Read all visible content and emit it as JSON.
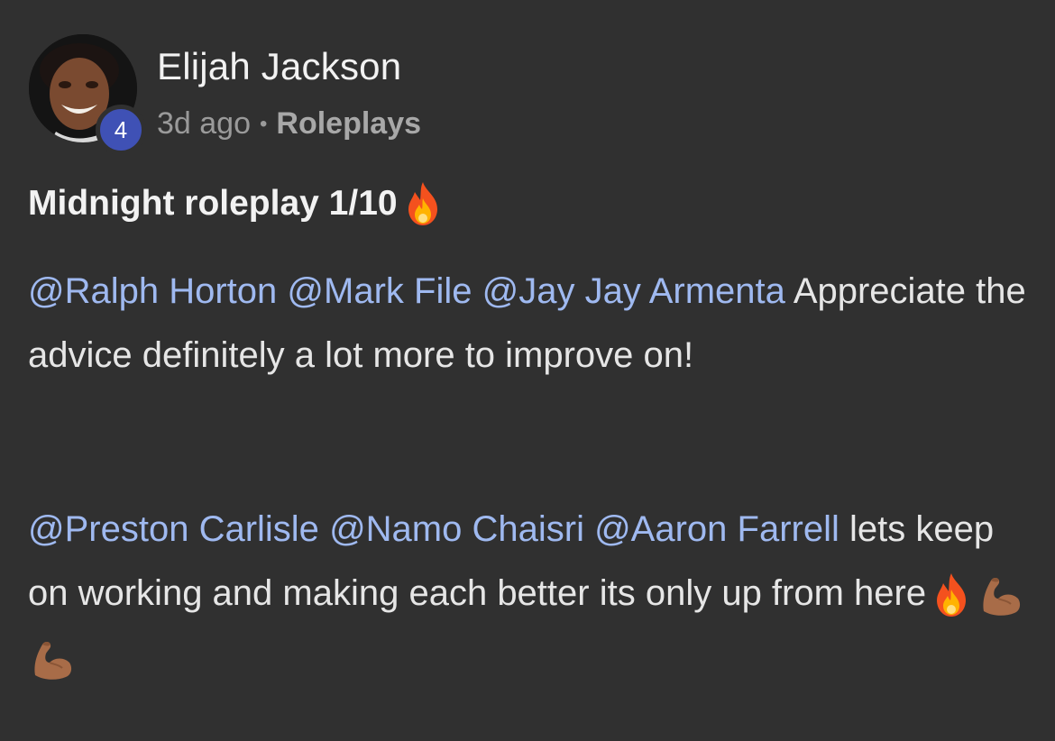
{
  "post": {
    "author": {
      "name": "Elijah Jackson",
      "level": "4"
    },
    "time": "3d ago",
    "separator": "•",
    "category": "Roleplays",
    "title": "Midnight roleplay 1/10",
    "paragraphs": [
      {
        "mentions": [
          "@Ralph Horton",
          "@Mark File",
          "@Jay Jay Armenta"
        ],
        "text": "Appreciate the advice definitely a lot more to improve on!"
      },
      {
        "mentions": [
          "@Preston Carlisle",
          "@Namo Chaisri",
          "@Aaron Farrell"
        ],
        "text": "lets keep on working and making each better its only up from here"
      }
    ],
    "emoji": {
      "title": "fire-emoji",
      "ending": [
        "fire-emoji",
        "flexed-biceps-emoji",
        "flexed-biceps-emoji"
      ]
    }
  },
  "colors": {
    "background": "#303030",
    "mention": "#9fb9f0",
    "badge": "#3f51b5",
    "meta": "#9a9a9a"
  }
}
